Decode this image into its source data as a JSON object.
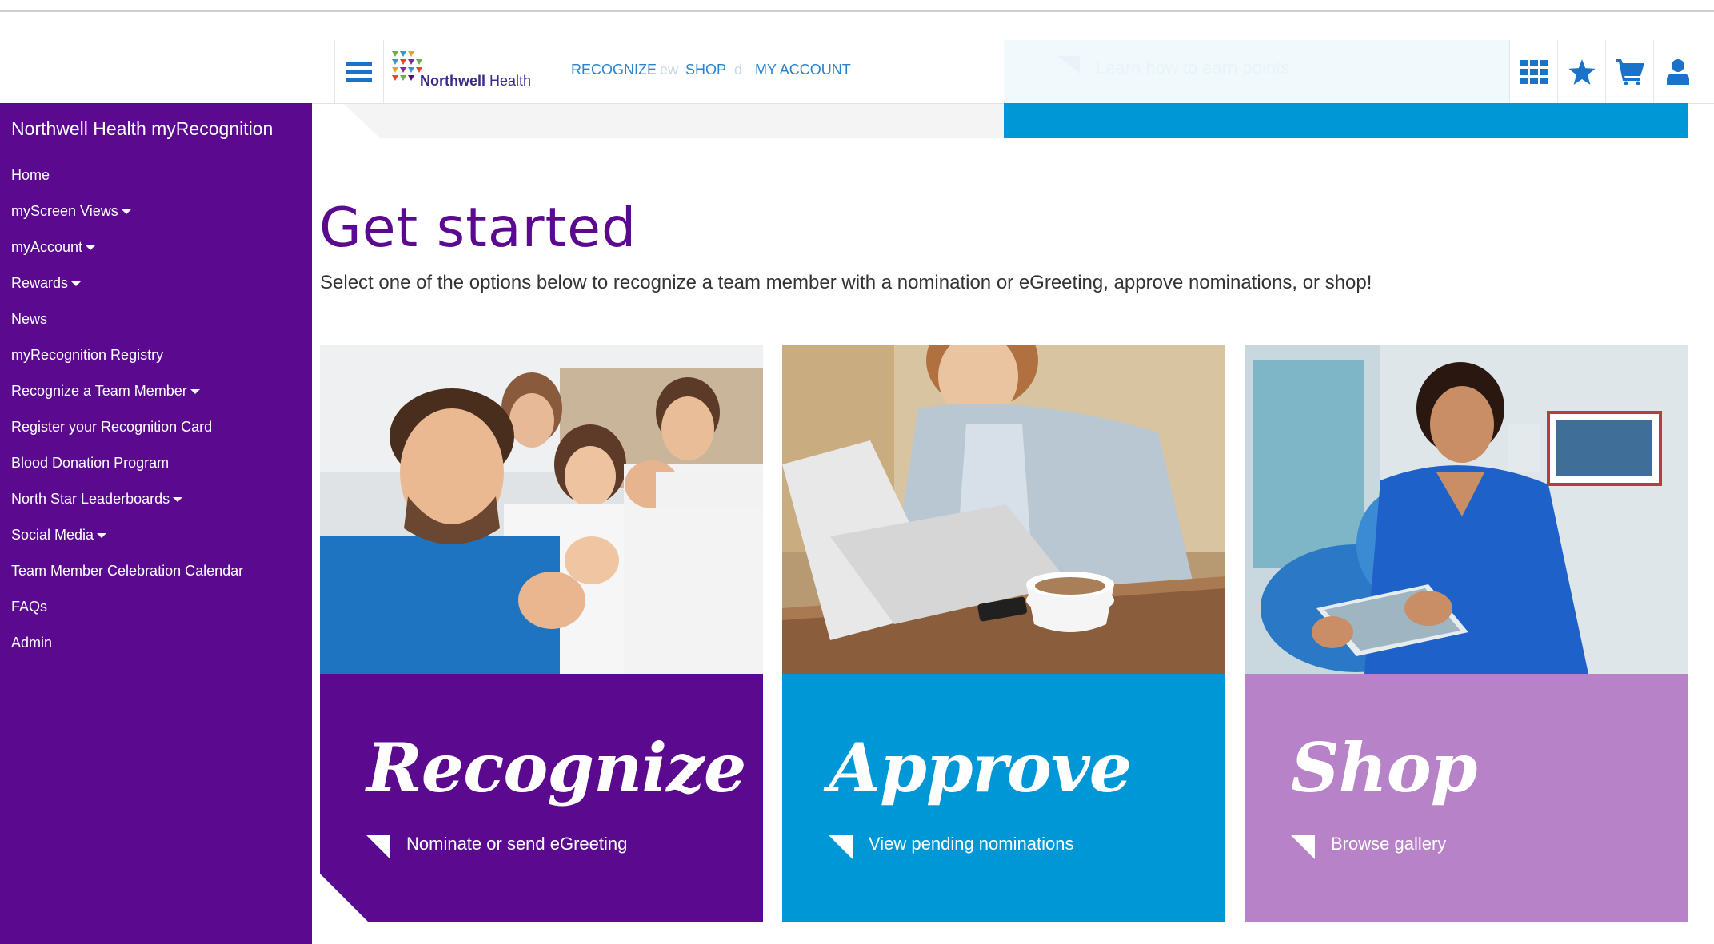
{
  "header": {
    "logo_brand": "Northwell",
    "logo_brand2": " Health",
    "nav": [
      "RECOGNIZE",
      "SHOP",
      "MY ACCOUNT"
    ],
    "faded_nav_1": "ew",
    "faded_nav_2": "d",
    "banner_text": "Learn how to earn points",
    "icons": [
      "grid-icon",
      "star-icon",
      "cart-icon",
      "user-icon"
    ],
    "accent": "#0097d6",
    "link_color": "#2a82cf"
  },
  "sidebar": {
    "title": "Northwell Health myRecognition",
    "color": "#5b0a90",
    "items": [
      {
        "label": "Home",
        "dropdown": false
      },
      {
        "label": "myScreen Views",
        "dropdown": true
      },
      {
        "label": "myAccount",
        "dropdown": true
      },
      {
        "label": "Rewards",
        "dropdown": true
      },
      {
        "label": "News",
        "dropdown": false
      },
      {
        "label": "myRecognition Registry",
        "dropdown": false
      },
      {
        "label": "Recognize a Team Member",
        "dropdown": true
      },
      {
        "label": "Register your Recognition Card",
        "dropdown": false
      },
      {
        "label": "Blood Donation Program",
        "dropdown": false
      },
      {
        "label": "North Star Leaderboards",
        "dropdown": true
      },
      {
        "label": "Social Media",
        "dropdown": true
      },
      {
        "label": "Team Member Celebration Calendar",
        "dropdown": false
      },
      {
        "label": "FAQs",
        "dropdown": false
      },
      {
        "label": "Admin",
        "dropdown": false
      }
    ]
  },
  "main": {
    "heading": "Get started",
    "subheading": "Select one of the options below to recognize a team member with a nomination or eGreeting, approve nominations, or shop!",
    "cards": [
      {
        "title": "Recognize",
        "subtitle": "Nominate or send eGreeting",
        "color": "#5b0a90",
        "image": "medical-team-selfie-photo"
      },
      {
        "title": "Approve",
        "subtitle": "View pending nominations",
        "color": "#0097d6",
        "image": "laptop-coffee-photo"
      },
      {
        "title": "Shop",
        "subtitle": "Browse gallery",
        "color": "#b882c8",
        "image": "nurse-with-tablet-photo"
      }
    ]
  }
}
